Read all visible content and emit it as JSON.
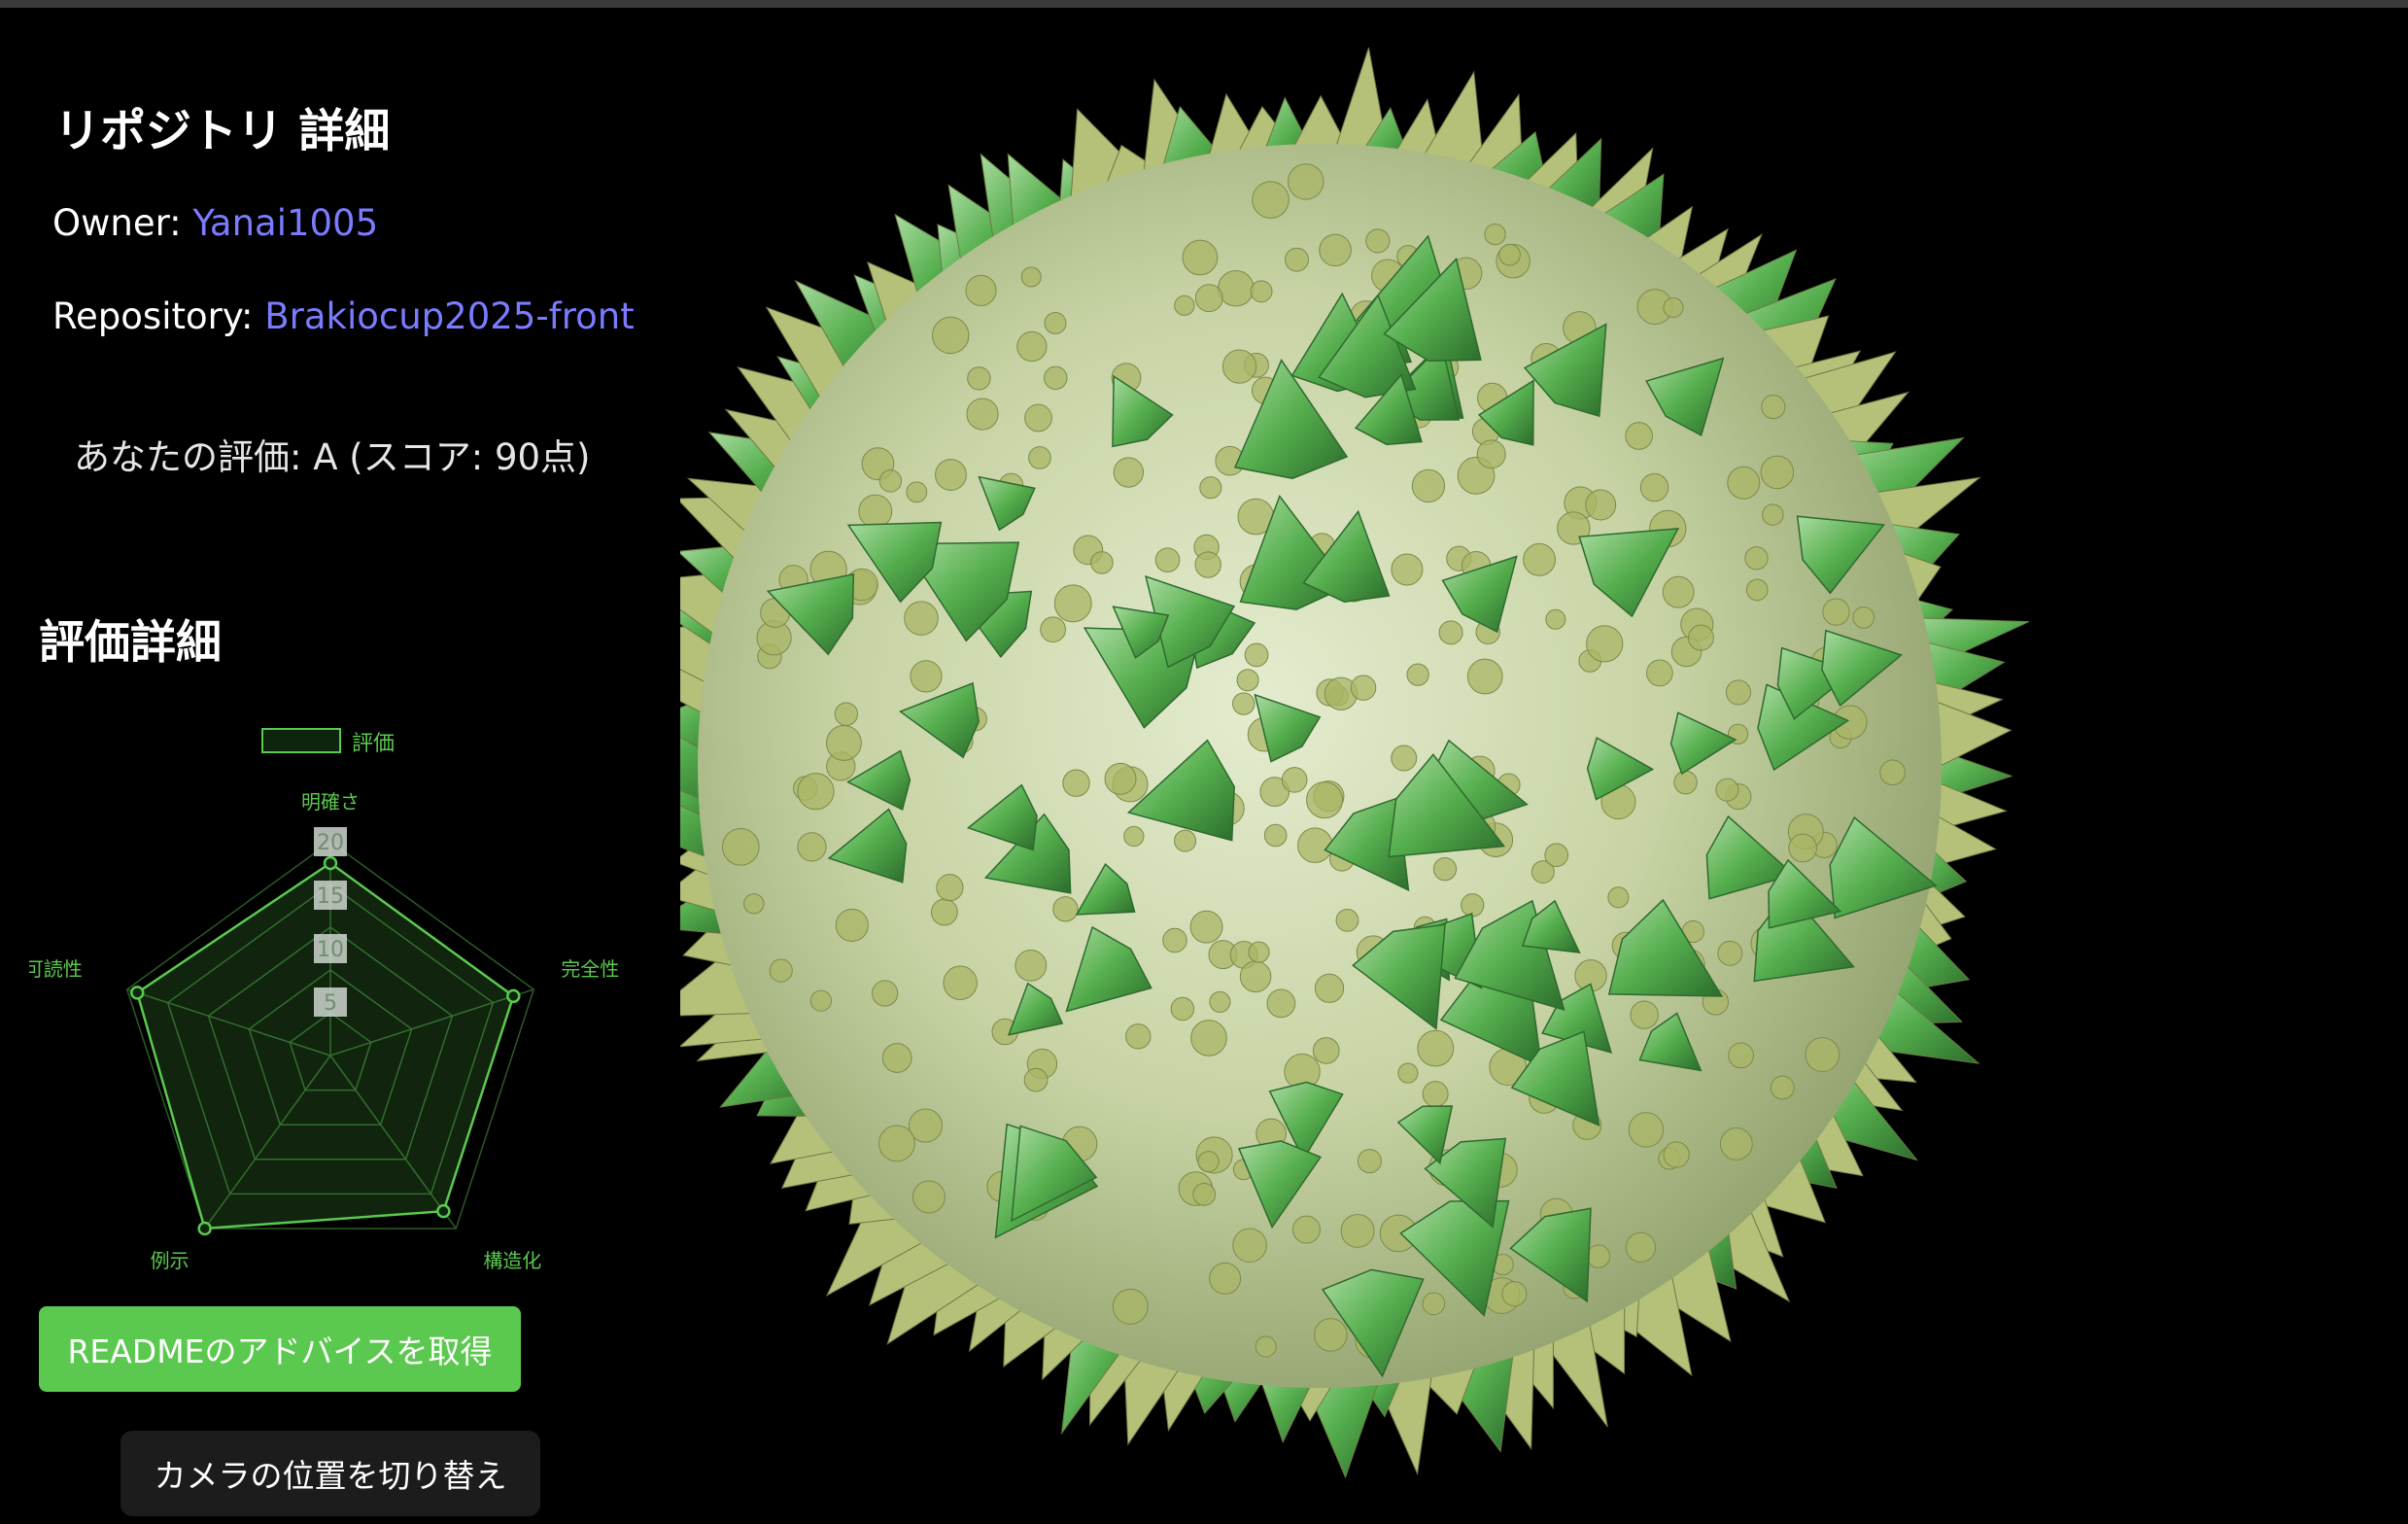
{
  "header": {
    "title": "リポジトリ 詳細"
  },
  "owner": {
    "label": "Owner: ",
    "value": "Yanai1005"
  },
  "repository": {
    "label": "Repository: ",
    "value": "Brakiocup2025-front"
  },
  "evaluation": {
    "text": "あなたの評価: A (スコア: 90点)"
  },
  "details": {
    "title": "評価詳細"
  },
  "chart_data": {
    "type": "radar",
    "legend": [
      "評価"
    ],
    "categories": [
      "明確さ",
      "完全性",
      "構造化",
      "例示",
      "可読性"
    ],
    "series": [
      {
        "name": "評価",
        "values": [
          18,
          18,
          18,
          20,
          19
        ]
      }
    ],
    "rmax": 20,
    "ticks": [
      "5",
      "10",
      "15",
      "20"
    ],
    "color": "#5bc94f"
  },
  "buttons": {
    "readme": "READMEのアドバイスを取得",
    "camera": "カメラの位置を切り替え"
  },
  "colors": {
    "accent": "#5bc94f",
    "link": "#7b7bff",
    "background": "#000000"
  }
}
